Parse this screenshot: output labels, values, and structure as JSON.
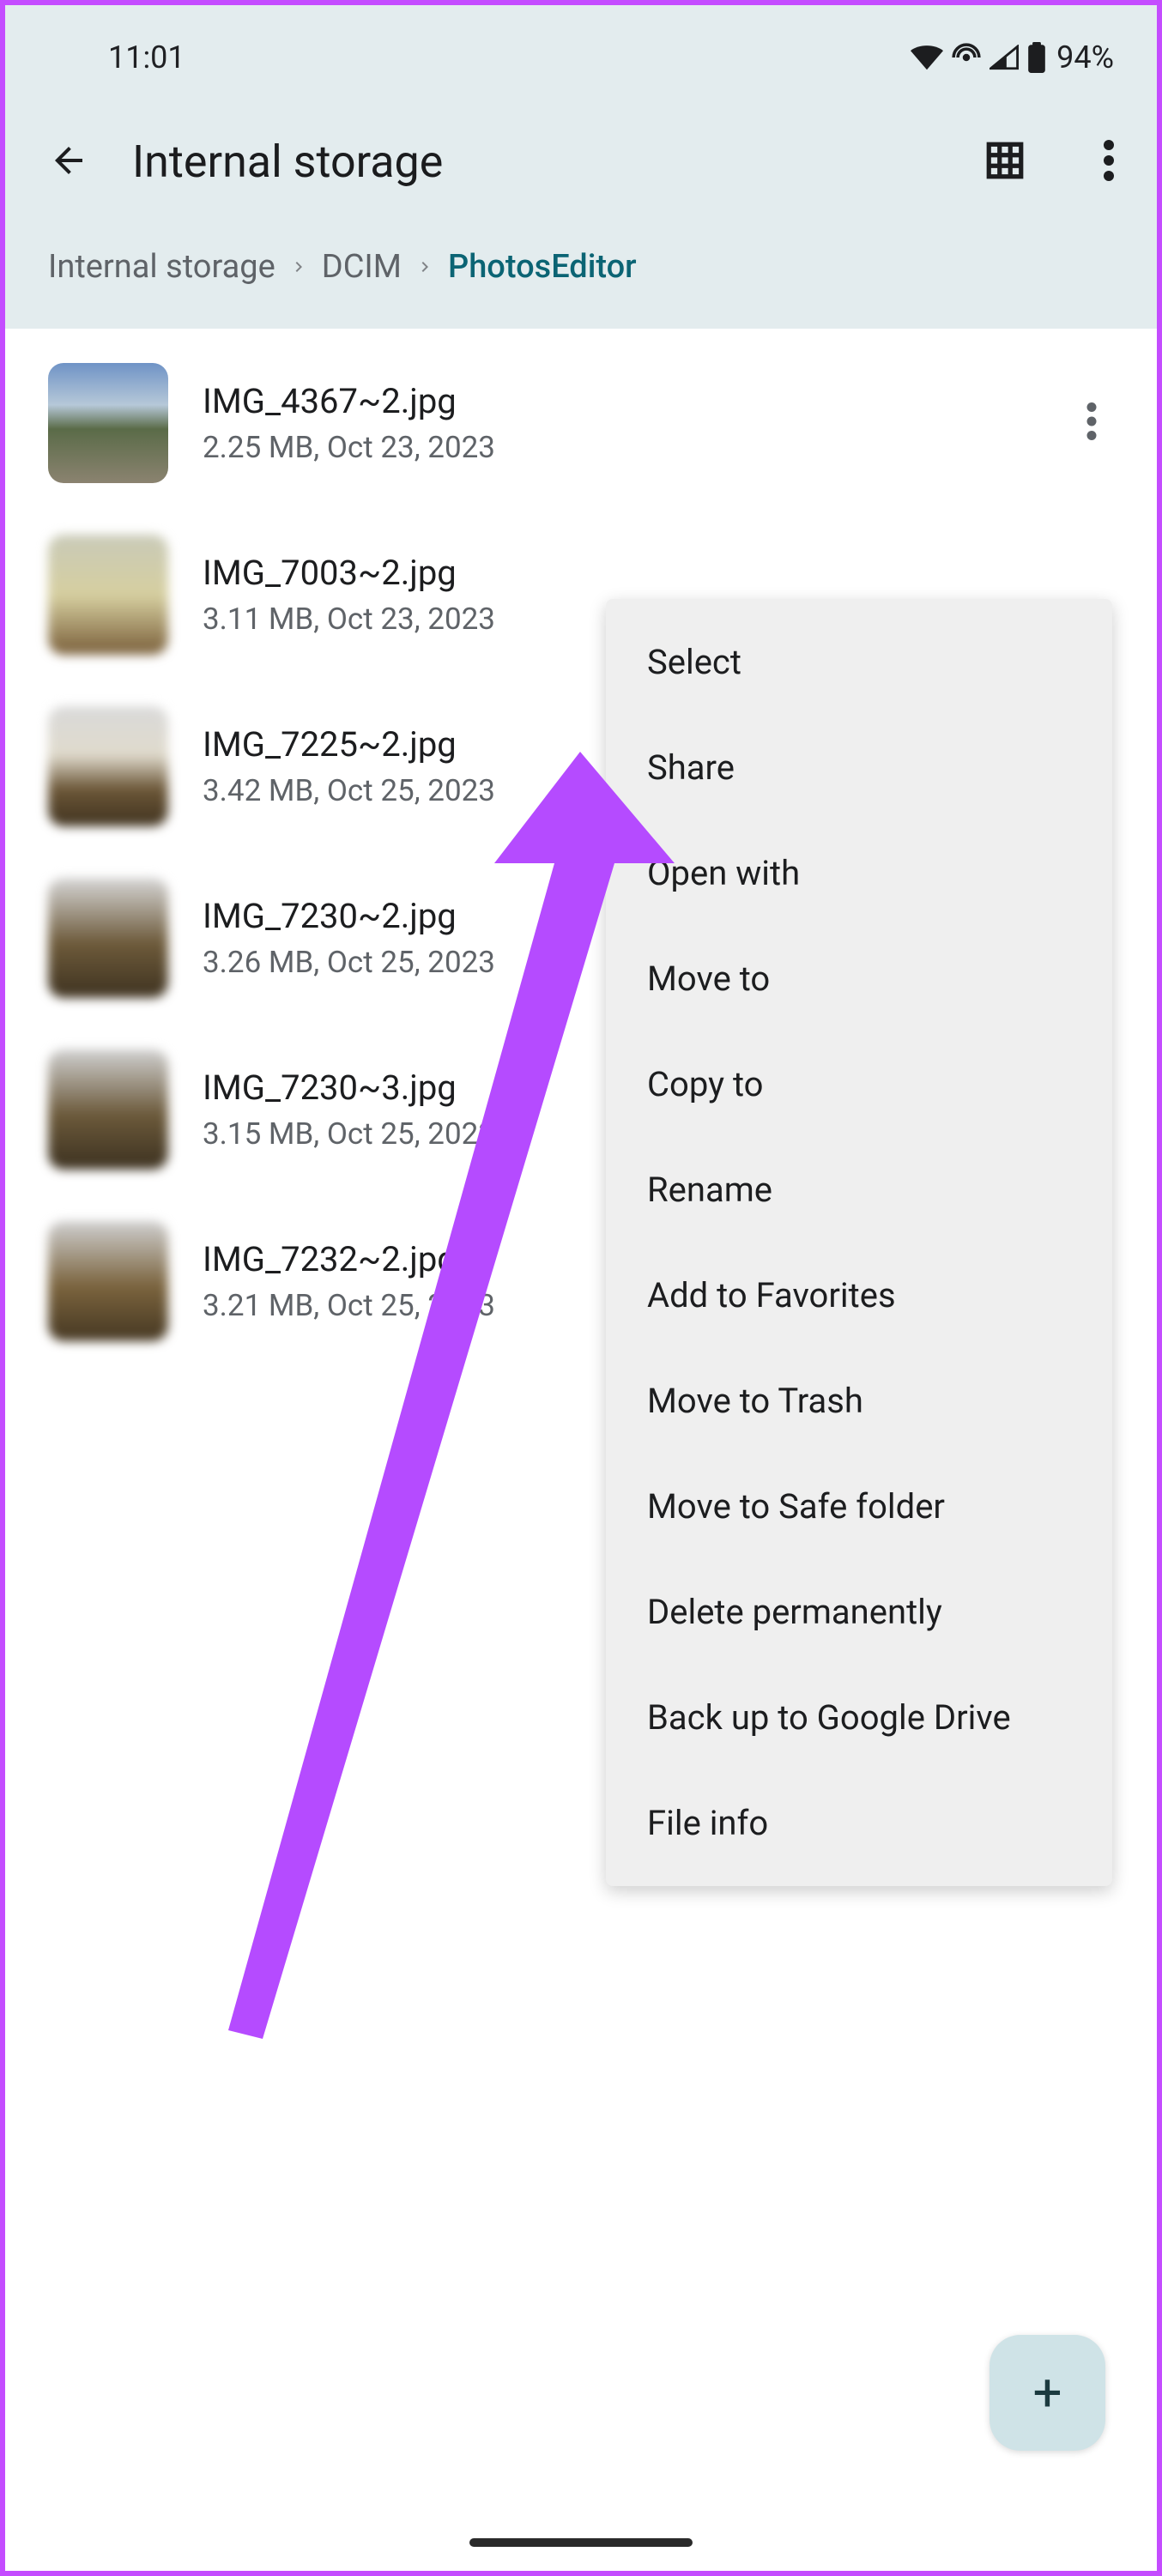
{
  "status": {
    "time": "11:01",
    "battery": "94%"
  },
  "header": {
    "title": "Internal storage"
  },
  "breadcrumb": {
    "items": [
      "Internal storage",
      "DCIM",
      "PhotosEditor"
    ]
  },
  "files": [
    {
      "name": "IMG_4367~2.jpg",
      "meta": "2.25 MB, Oct 23, 2023"
    },
    {
      "name": "IMG_7003~2.jpg",
      "meta": "3.11 MB, Oct 23, 2023"
    },
    {
      "name": "IMG_7225~2.jpg",
      "meta": "3.42 MB, Oct 25, 2023"
    },
    {
      "name": "IMG_7230~2.jpg",
      "meta": "3.26 MB, Oct 25, 2023"
    },
    {
      "name": "IMG_7230~3.jpg",
      "meta": "3.15 MB, Oct 25, 2023"
    },
    {
      "name": "IMG_7232~2.jpg",
      "meta": "3.21 MB, Oct 25, 2023"
    }
  ],
  "menu": {
    "items": [
      "Select",
      "Share",
      "Open with",
      "Move to",
      "Copy to",
      "Rename",
      "Add to Favorites",
      "Move to Trash",
      "Move to Safe folder",
      "Delete permanently",
      "Back up to Google Drive",
      "File info"
    ]
  },
  "fab": {
    "label": "+"
  }
}
